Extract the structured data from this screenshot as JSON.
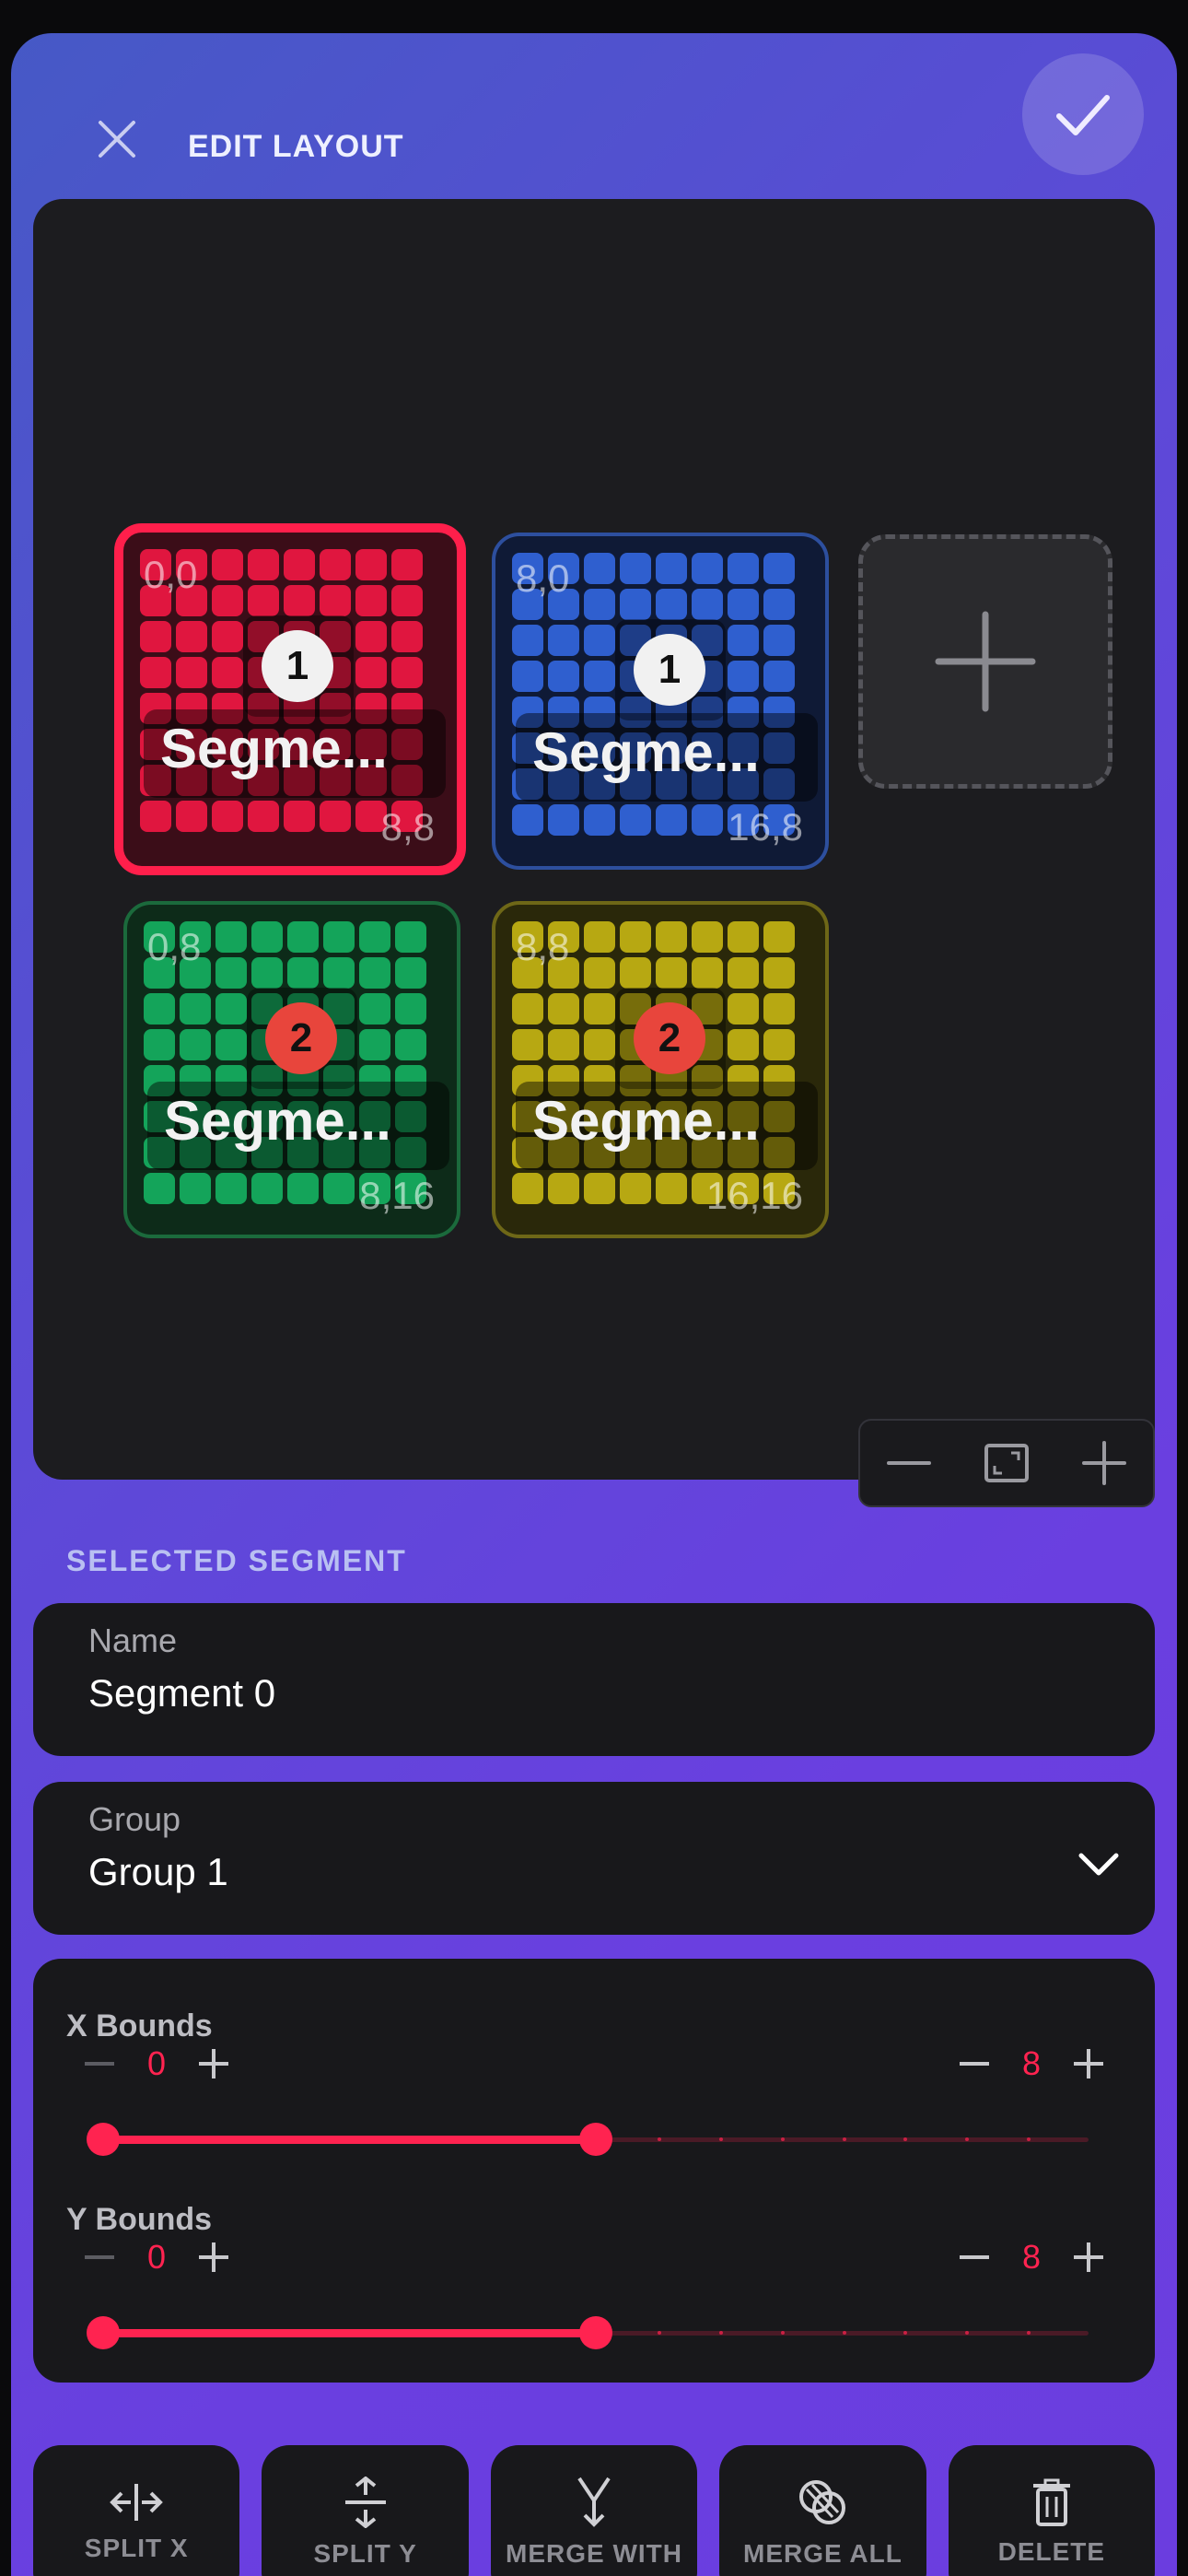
{
  "header": {
    "title": "EDIT LAYOUT",
    "close_icon": "close-icon",
    "confirm_icon": "check-icon"
  },
  "canvas": {
    "segments": [
      {
        "name": "Segme...",
        "coord_start": "0,0",
        "coord_end": "8,8",
        "group_badge": "1",
        "color": "#e0163f",
        "selected": true
      },
      {
        "name": "Segme...",
        "coord_start": "8,0",
        "coord_end": "16,8",
        "group_badge": "1",
        "color": "#2f5fcf",
        "selected": false
      },
      {
        "name": "Segme...",
        "coord_start": "0,8",
        "coord_end": "8,16",
        "group_badge": "2",
        "color": "#14a45a",
        "selected": false
      },
      {
        "name": "Segme...",
        "coord_start": "8,8",
        "coord_end": "16,16",
        "group_badge": "2",
        "color": "#b7a812",
        "selected": false
      }
    ],
    "add_icon": "plus-icon",
    "zoom": {
      "out_icon": "minus-icon",
      "fit_icon": "fit-screen-icon",
      "in_icon": "plus-icon"
    }
  },
  "selected_segment": {
    "section_label": "SELECTED SEGMENT",
    "name_label": "Name",
    "name_value": "Segment 0",
    "group_label": "Group",
    "group_value": "Group 1",
    "x_bounds": {
      "label": "X Bounds",
      "min": "0",
      "max": "8",
      "range": [
        0,
        8
      ],
      "scale_max": 16
    },
    "y_bounds": {
      "label": "Y Bounds",
      "min": "0",
      "max": "8",
      "range": [
        0,
        8
      ],
      "scale_max": 16
    }
  },
  "actions": [
    {
      "label": "SPLIT X",
      "icon": "split-x-icon"
    },
    {
      "label": "SPLIT Y",
      "icon": "split-y-icon"
    },
    {
      "label": "MERGE WITH",
      "icon": "merge-with-icon"
    },
    {
      "label": "MERGE ALL",
      "icon": "merge-all-icon"
    },
    {
      "label": "DELETE",
      "icon": "trash-icon"
    }
  ],
  "colors": {
    "accent": "#ff2350",
    "selected_border": "#ff1f4b"
  }
}
